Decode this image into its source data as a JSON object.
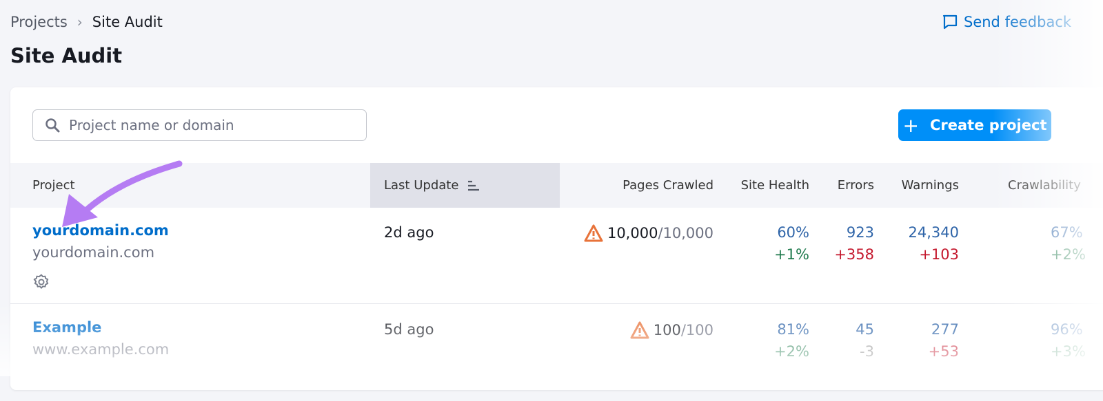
{
  "breadcrumb": {
    "items": [
      "Projects",
      "Site Audit"
    ]
  },
  "feedback_label": "Send feedback",
  "page_title": "Site Audit",
  "search": {
    "placeholder": "Project name or domain",
    "value": ""
  },
  "create_label": "Create project",
  "columns": [
    "Project",
    "Last Update",
    "Pages Crawled",
    "Site Health",
    "Errors",
    "Warnings",
    "Crawlability"
  ],
  "rows": [
    {
      "name": "yourdomain.com",
      "domain": "yourdomain.com",
      "last_update": "2d ago",
      "pages": "10,000",
      "pages_limit": "/10,000",
      "health": "60%",
      "health_delta": "+1%",
      "errors": "923",
      "errors_delta": "+358",
      "warnings": "24,340",
      "warnings_delta": "+103",
      "crawlability": "67%",
      "crawlability_delta": "+2%"
    },
    {
      "name": "Example",
      "domain": "www.example.com",
      "last_update": "5d ago",
      "pages": "100",
      "pages_limit": "/100",
      "health": "81%",
      "health_delta": "+2%",
      "errors": "45",
      "errors_delta": "-3",
      "warnings": "277",
      "warnings_delta": "+53",
      "crawlability": "96%",
      "crawlability_delta": "+3%"
    }
  ],
  "colors": {
    "accent": "#008ff8",
    "link": "#006dca",
    "warning": "#e8733a",
    "arrow": "#b57cf3"
  }
}
